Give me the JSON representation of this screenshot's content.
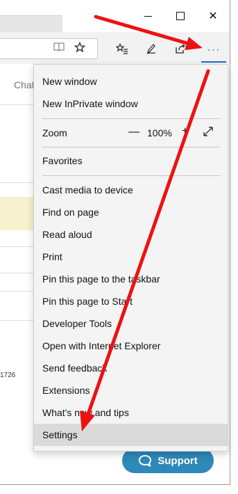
{
  "window": {
    "minimize_glyph": "",
    "maximize_glyph": "",
    "close_glyph": "✕"
  },
  "toolbar": {
    "reading_view_icon": "book-icon",
    "favorite_icon": "star-icon",
    "favorites_bar_icon": "favorites-icon",
    "notes_icon": "pen-icon",
    "share_icon": "share-icon",
    "more_label": "···"
  },
  "page": {
    "chat_link": "Chat",
    "number_text": "1726",
    "support_label": "Support"
  },
  "menu": {
    "new_window": "New window",
    "new_inprivate": "New InPrivate window",
    "zoom_label": "Zoom",
    "zoom_minus": "—",
    "zoom_value": "100%",
    "zoom_plus": "+",
    "favorites": "Favorites",
    "cast_media": "Cast media to device",
    "find_on_page": "Find on page",
    "read_aloud": "Read aloud",
    "print": "Print",
    "pin_taskbar": "Pin this page to the taskbar",
    "pin_start": "Pin this page to Start",
    "developer_tools": "Developer Tools",
    "open_ie": "Open with Internet Explorer",
    "send_feedback": "Send feedback",
    "extensions": "Extensions",
    "whats_new": "What's new and tips",
    "settings": "Settings"
  },
  "colors": {
    "accent": "#1a6fd0",
    "arrow": "#ee1111",
    "support_button": "#2e88b8"
  }
}
